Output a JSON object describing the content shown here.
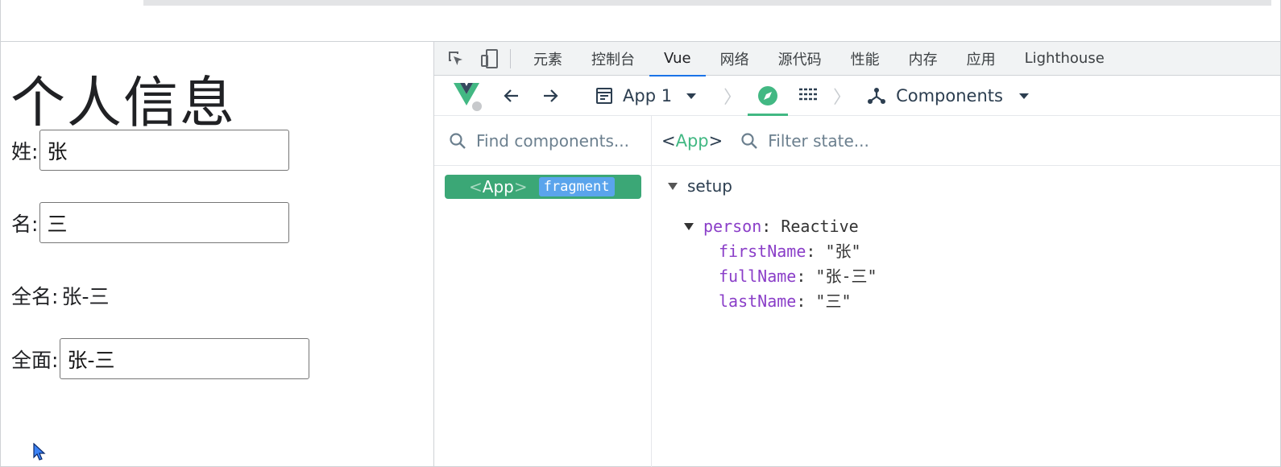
{
  "page": {
    "heading": "个人信息",
    "fields": [
      {
        "label": "姓:",
        "value": "张"
      },
      {
        "label": "名:",
        "value": "三"
      }
    ],
    "fullname": {
      "label": "全名:",
      "value": "张-三"
    },
    "full_input": {
      "label": "全面:",
      "value": "张-三"
    }
  },
  "devtools": {
    "tabs": [
      "元素",
      "控制台",
      "Vue",
      "网络",
      "源代码",
      "性能",
      "内存",
      "应用",
      "Lighthouse"
    ],
    "active_tab": "Vue",
    "app_selector": "App 1",
    "view_selector": "Components",
    "find_placeholder": "Find components...",
    "filter_placeholder": "Filter state...",
    "selected_component": {
      "lt": "<",
      "name": "App",
      "gt": ">"
    },
    "tree_node": {
      "name": "App",
      "badge": "fragment"
    },
    "setup_label": "setup",
    "state": {
      "object_key": "person",
      "object_type": "Reactive",
      "props": [
        {
          "key": "firstName",
          "value": "\"张\""
        },
        {
          "key": "fullName",
          "value": "\"张-三\""
        },
        {
          "key": "lastName",
          "value": "\"三\""
        }
      ]
    }
  },
  "colors": {
    "vue_green": "#42b883",
    "node_green": "#3ba776",
    "badge_blue": "#5aa4ec",
    "key_purple": "#8a3ec8",
    "tab_blue": "#1a73e8"
  }
}
